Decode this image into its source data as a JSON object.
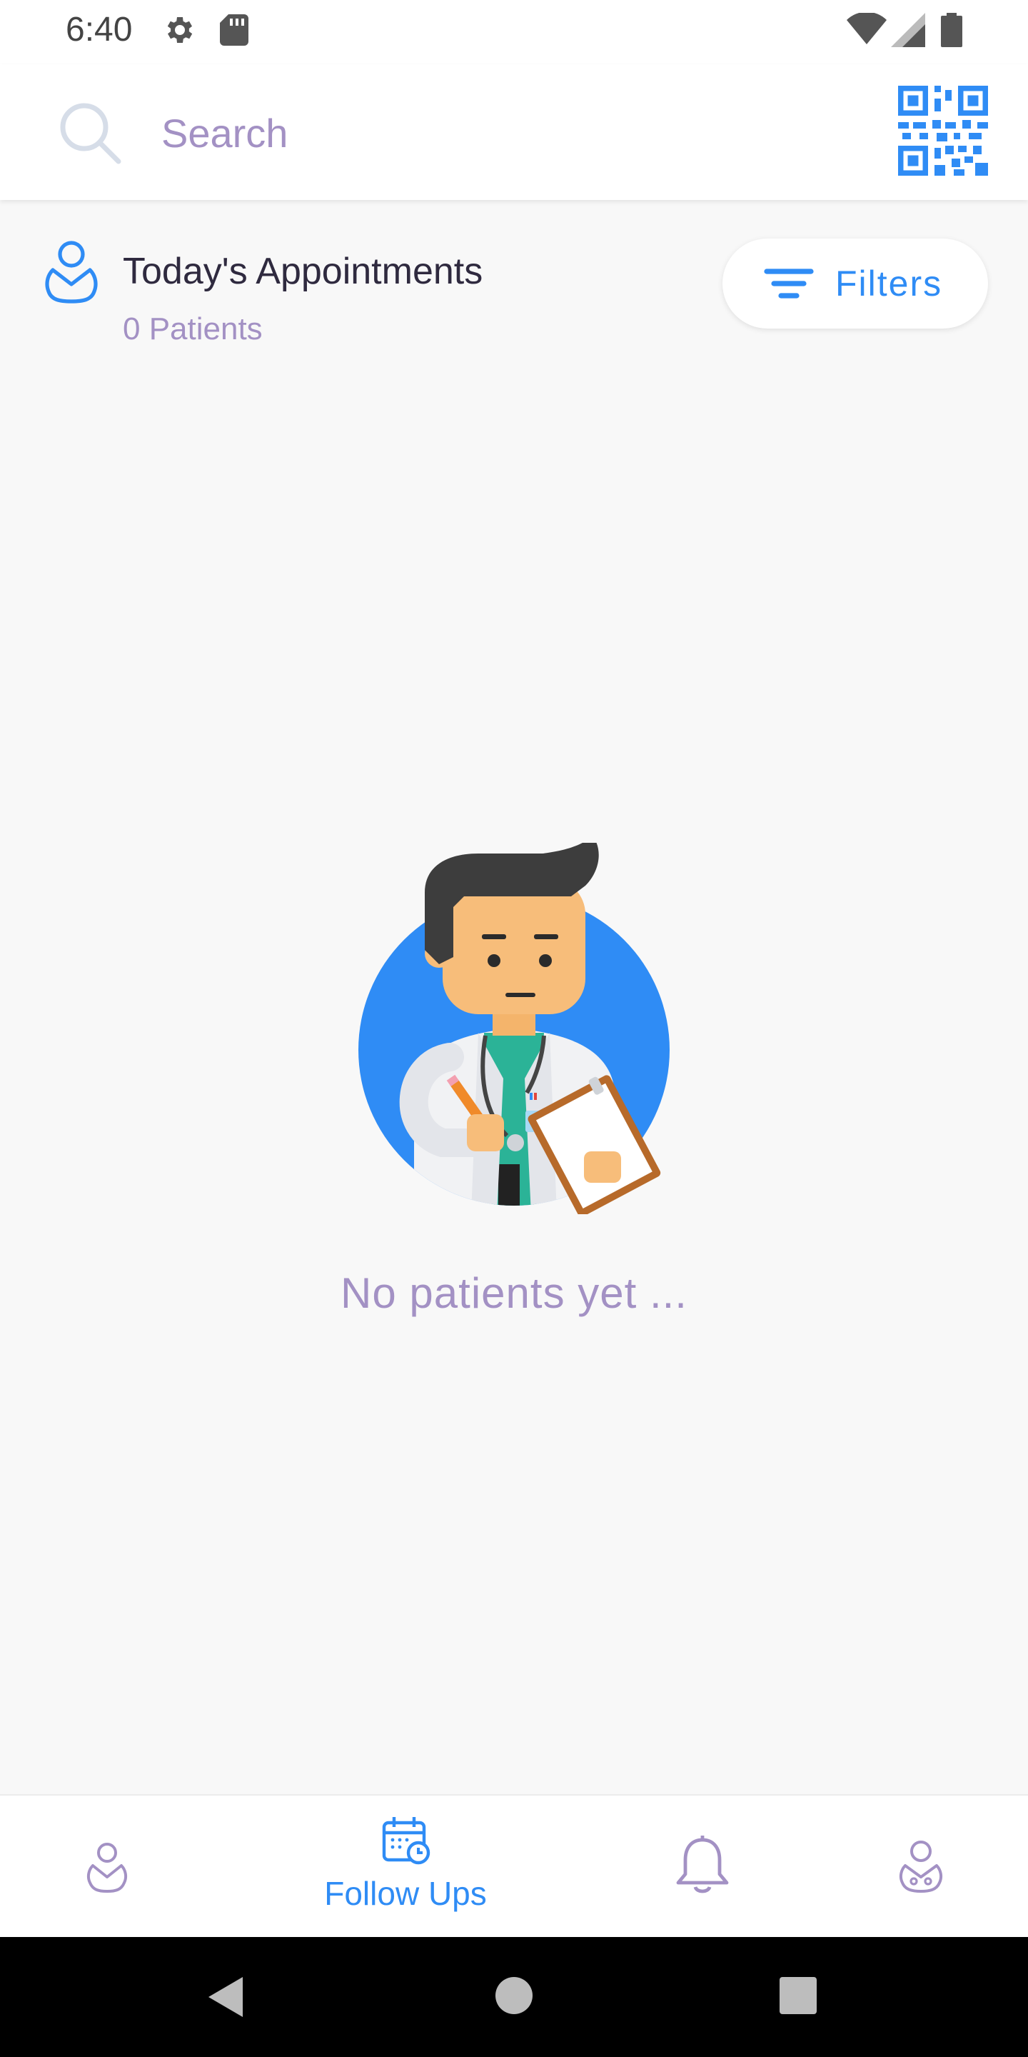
{
  "status_bar": {
    "time": "6:40",
    "left_icons": [
      "gear-icon",
      "sd-card-icon"
    ],
    "right_icons": [
      "wifi-icon",
      "signal-icon",
      "battery-icon"
    ]
  },
  "header": {
    "search_placeholder": "Search",
    "qr_icon": "qr-code-icon"
  },
  "appointments": {
    "title": "Today's Appointments",
    "count_label": "0 Patients",
    "filters_label": "Filters"
  },
  "empty_state": {
    "message": "No patients yet ..."
  },
  "bottom_nav": {
    "items": [
      {
        "icon": "patient-icon",
        "label": ""
      },
      {
        "icon": "calendar-clock-icon",
        "label": "Follow Ups"
      },
      {
        "icon": "bell-icon",
        "label": ""
      },
      {
        "icon": "doctor-icon",
        "label": ""
      }
    ],
    "active_index": 1
  },
  "colors": {
    "accent": "#2f8cf5",
    "muted_text": "#a391c4",
    "title_text": "#2f2a3f",
    "background": "#f8f8f8"
  }
}
